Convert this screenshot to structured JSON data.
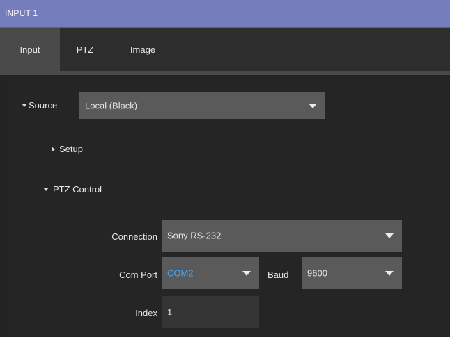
{
  "window": {
    "title": "INPUT 1"
  },
  "tabs": [
    {
      "label": "Input",
      "active": true
    },
    {
      "label": "PTZ",
      "active": false
    },
    {
      "label": "Image",
      "active": false
    }
  ],
  "source": {
    "label": "Source",
    "value": "Local (Black)"
  },
  "setup": {
    "label": "Setup",
    "expanded": false
  },
  "ptz_control": {
    "label": "PTZ Control",
    "expanded": true,
    "connection": {
      "label": "Connection",
      "value": "Sony RS-232"
    },
    "com_port": {
      "label": "Com Port",
      "value": "COM2"
    },
    "baud": {
      "label": "Baud",
      "value": "9600"
    },
    "index": {
      "label": "Index",
      "value": "1"
    }
  },
  "colors": {
    "title_bar": "#767dbc",
    "active_tab": "#4a4a4a",
    "dropdown": "#5a5a5a",
    "selection_text": "#3fa7ff"
  }
}
